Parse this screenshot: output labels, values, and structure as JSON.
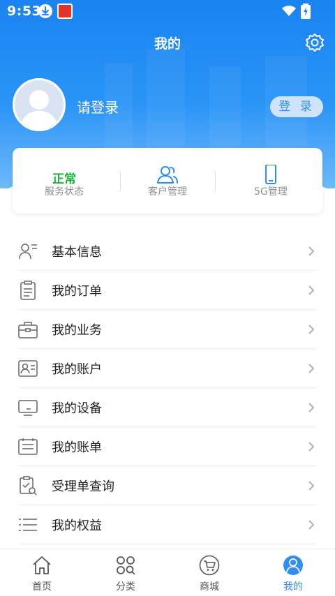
{
  "status_bar": {
    "time": "9:53"
  },
  "header": {
    "title": "我的"
  },
  "profile": {
    "login_prompt": "请登录",
    "login_button": "登 录"
  },
  "summary_card": {
    "items": [
      {
        "value": "正常",
        "label": "服务状态"
      },
      {
        "label": "客户管理",
        "icon": "users-icon"
      },
      {
        "label": "5G管理",
        "icon": "phone-icon"
      }
    ]
  },
  "menu": [
    {
      "label": "基本信息",
      "icon": "user-info-icon"
    },
    {
      "label": "我的订单",
      "icon": "clipboard-icon"
    },
    {
      "label": "我的业务",
      "icon": "briefcase-icon"
    },
    {
      "label": "我的账户",
      "icon": "id-card-icon"
    },
    {
      "label": "我的设备",
      "icon": "monitor-icon"
    },
    {
      "label": "我的账单",
      "icon": "bill-icon"
    },
    {
      "label": "受理单查询",
      "icon": "search-clipboard-icon"
    },
    {
      "label": "我的权益",
      "icon": "list-icon"
    }
  ],
  "tabbar": [
    {
      "label": "首页",
      "icon": "home-icon"
    },
    {
      "label": "分类",
      "icon": "category-icon"
    },
    {
      "label": "商城",
      "icon": "cart-icon"
    },
    {
      "label": "我的",
      "icon": "profile-icon",
      "active": true
    }
  ],
  "colors": {
    "primary": "#2f8ef0",
    "status_ok": "#1db23d",
    "hero_top": "#1a83f2"
  }
}
